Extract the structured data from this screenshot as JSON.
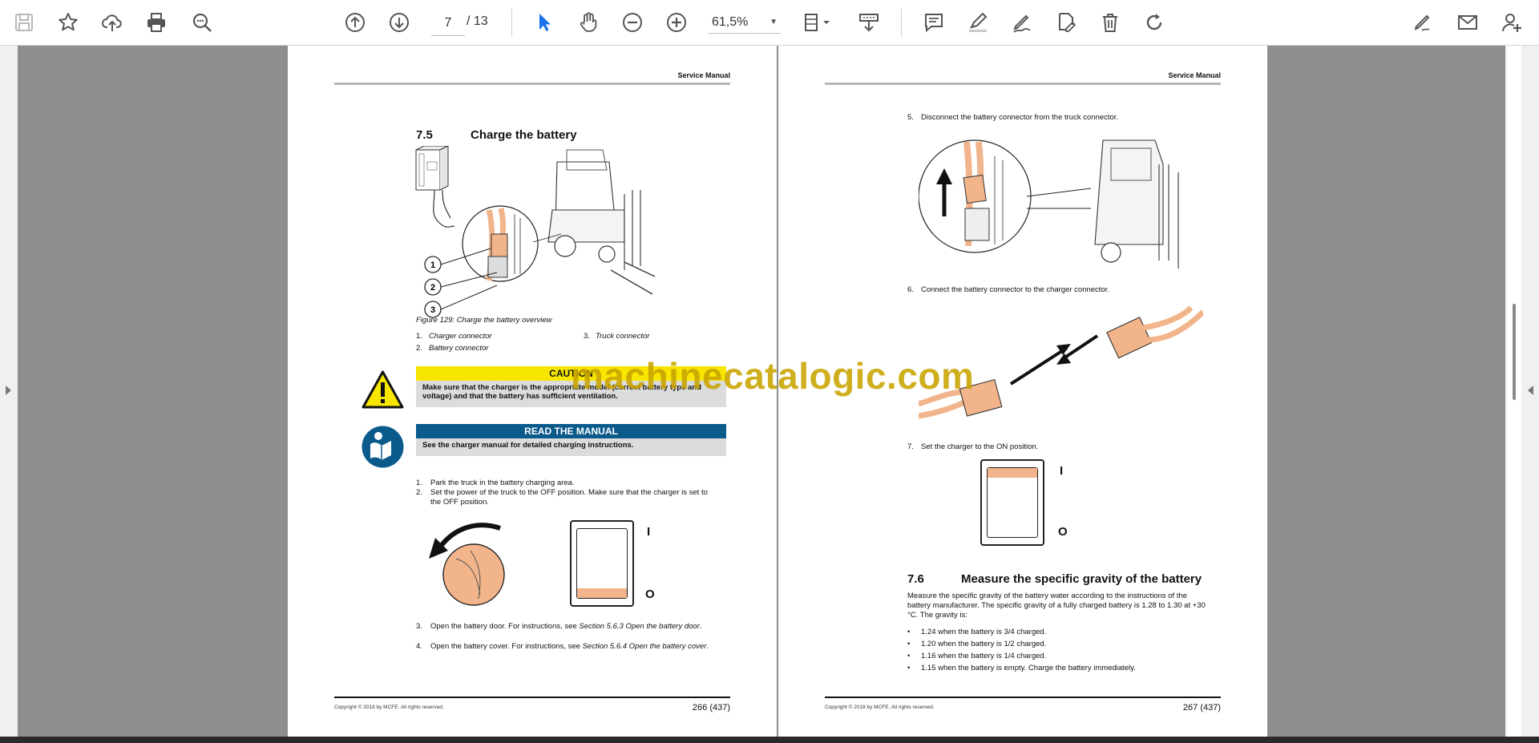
{
  "toolbar": {
    "current_page": "7",
    "total_pages": "/ 13",
    "zoom": "61,5%",
    "icons": [
      "save-icon",
      "bookmark-star-icon",
      "cloud-upload-icon",
      "print-icon",
      "zoom-search-icon",
      "page-up-icon",
      "page-down-icon",
      "select-cursor-icon",
      "hand-tool-icon",
      "zoom-out-icon",
      "zoom-in-icon",
      "page-fit-icon",
      "download-icon",
      "comment-icon",
      "highlight-icon",
      "draw-icon",
      "stamp-icon",
      "delete-icon",
      "rotate-icon",
      "edit-sign-icon",
      "email-icon",
      "add-user-icon"
    ]
  },
  "left_page": {
    "header": "Service Manual",
    "section_number": "7.5",
    "section_title": "Charge the battery",
    "callouts": [
      "1",
      "2",
      "3"
    ],
    "figure_caption": "Figure 129: Charge the battery overview",
    "legend": [
      {
        "num": "1.",
        "text": "Charger connector"
      },
      {
        "num": "2.",
        "text": "Battery connector"
      },
      {
        "num": "3.",
        "text": "Truck connector"
      }
    ],
    "caution": {
      "title": "CAUTION",
      "text": "Make sure that the charger is the appropriate model (correct battery type and voltage) and that the battery has sufficient ventilation."
    },
    "read_manual": {
      "title": "READ THE MANUAL",
      "text": "See the charger manual for detailed charging instructions."
    },
    "steps_a": [
      {
        "num": "1.",
        "text": "Park the truck in the battery charging area."
      },
      {
        "num": "2.",
        "text": "Set the power of the truck to the OFF position. Make sure that the charger is set to the OFF position."
      }
    ],
    "switch_on_label": "I",
    "switch_off_label": "O",
    "steps_b": [
      {
        "num": "3.",
        "text": "Open the battery door. For instructions, see ",
        "ref": "Section 5.6.3 Open the battery door",
        "tail": "."
      },
      {
        "num": "4.",
        "text": "Open the battery cover. For instructions, see ",
        "ref": "Section 5.6.4 Open the battery cover",
        "tail": "."
      }
    ],
    "copyright": "Copyright © 2018 by MCFE. All rights reserved.",
    "page_number": "266 (437)"
  },
  "right_page": {
    "header": "Service Manual",
    "step5": {
      "num": "5.",
      "text": "Disconnect the battery connector from the truck connector."
    },
    "step6": {
      "num": "6.",
      "text": "Connect the battery connector to the charger connector."
    },
    "step7": {
      "num": "7.",
      "text": "Set the charger to the ON position."
    },
    "switch_on_label": "I",
    "switch_off_label": "O",
    "section_number": "7.6",
    "section_title": "Measure the specific gravity of the battery",
    "intro": "Measure the specific gravity of the battery water according to the instructions of the battery manufacturer. The specific gravity of a fully charged battery is 1.28 to 1.30 at +30 °C. The gravity is:",
    "bullets": [
      "1.24 when the battery is 3/4 charged.",
      "1.20 when the battery is 1/2 charged.",
      "1.16 when the battery is 1/4 charged.",
      "1.15 when the battery is empty. Charge the battery immediately."
    ],
    "copyright": "Copyright © 2018 by MCFE. All rights reserved.",
    "page_number": "267 (437)"
  },
  "watermark": "machinecatalogic.com",
  "colors": {
    "caution_yellow": "#f7e600",
    "read_manual_blue": "#0a5a8c",
    "connector_orange": "#f2b48a",
    "viewer_gray": "#8e8e8e"
  }
}
